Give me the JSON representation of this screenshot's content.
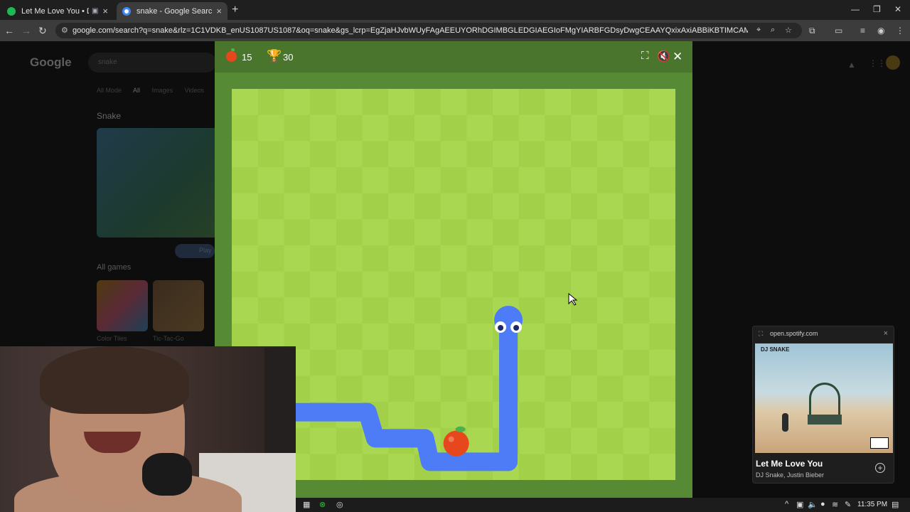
{
  "browser": {
    "tabs": [
      {
        "title": "Let Me Love You • DJ Snake",
        "active": false,
        "favicon_color": "#1db954"
      },
      {
        "title": "snake - Google Search",
        "active": true,
        "favicon_color": "#ffffff"
      }
    ],
    "url": "google.com/search?q=snake&rlz=1C1VDKB_enUS1087US1087&oq=snake&gs_lcrp=EgZjaHJvbWUyFAgAEEUYORhDGIMBGLEDGIAEGIoFMgYIARBFGDsyDwgCEAAYQxixAxiABBiKBTIMCAMQABhDGIAEGIoFMgoIBBAuGLEDGIAEMhII..."
  },
  "google_page": {
    "logo": "Google",
    "search_value": "snake",
    "tabs": [
      "All Mode",
      "All",
      "Images",
      "Videos",
      "Sh"
    ],
    "result_title": "Snake",
    "play_label": "Play",
    "all_games_label": "All games",
    "games": [
      "Color Tiles",
      "Tic-Tac-Go"
    ]
  },
  "game": {
    "score": "15",
    "high_score": "30",
    "colors": {
      "light": "#aad751",
      "dark": "#a2d149",
      "border": "#578a34",
      "header": "#4a752c",
      "snake": "#4e7cf6",
      "apple": "#e7471d"
    },
    "board": {
      "cols": 17,
      "rows": 15
    },
    "snake_path": [
      [
        2.5,
        12.4
      ],
      [
        5.2,
        12.4
      ],
      [
        5.5,
        13.4
      ],
      [
        7.4,
        13.4
      ],
      [
        7.6,
        14.3
      ],
      [
        10.6,
        14.3
      ],
      [
        10.6,
        8.7
      ]
    ],
    "apple": [
      8.6,
      13.6
    ],
    "cursor_visible": true
  },
  "spotify": {
    "source": "open.spotify.com",
    "song": "Let Me Love You",
    "artist": "DJ Snake, Justin Bieber",
    "album_label": "DJ SNAKE"
  },
  "taskbar": {
    "time": "11:35 PM"
  }
}
